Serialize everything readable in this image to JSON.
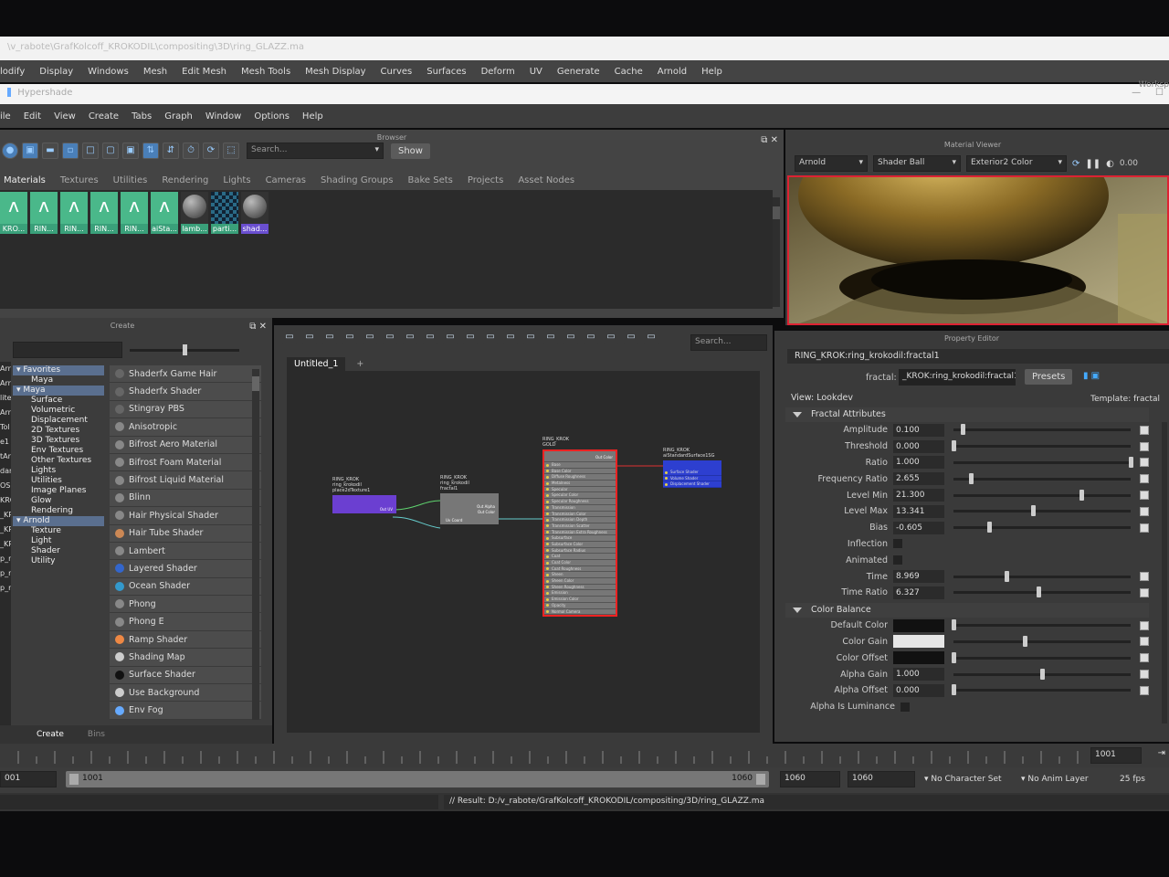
{
  "window": {
    "title": "\\v_rabote\\GrafKolcoff_KROKODIL\\compositing\\3D\\ring_GLAZZ.ma"
  },
  "main_menu": [
    "lodify",
    "Display",
    "Windows",
    "Mesh",
    "Edit Mesh",
    "Mesh Tools",
    "Mesh Display",
    "Curves",
    "Surfaces",
    "Deform",
    "UV",
    "Generate",
    "Cache",
    "Arnold",
    "Help"
  ],
  "workspace_label": "Worksp",
  "hypershade": {
    "title": "Hypershade",
    "menu": [
      "ile",
      "Edit",
      "View",
      "Create",
      "Tabs",
      "Graph",
      "Window",
      "Options",
      "Help"
    ]
  },
  "browser": {
    "title": "Browser",
    "search_placeholder": "Search...",
    "show_label": "Show",
    "tabs": [
      "Materials",
      "Textures",
      "Utilities",
      "Rendering",
      "Lights",
      "Cameras",
      "Shading Groups",
      "Bake Sets",
      "Projects",
      "Asset Nodes"
    ],
    "swatches": [
      {
        "label": "KRO...",
        "kind": "arnold"
      },
      {
        "label": "RIN...",
        "kind": "arnold"
      },
      {
        "label": "RIN...",
        "kind": "arnold"
      },
      {
        "label": "RIN...",
        "kind": "arnold"
      },
      {
        "label": "RIN...",
        "kind": "arnold"
      },
      {
        "label": "aiSta...",
        "kind": "arnold"
      },
      {
        "label": "lamb...",
        "kind": "sphere"
      },
      {
        "label": "parti...",
        "kind": "checker"
      },
      {
        "label": "shad...",
        "kind": "sphere"
      }
    ]
  },
  "material_viewer": {
    "title": "Material Viewer",
    "renderer": "Arnold",
    "shape": "Shader Ball",
    "env": "Exterior2 Color",
    "exposure": "0.00"
  },
  "create_panel": {
    "title": "Create",
    "tree": [
      {
        "label": "Favorites",
        "level": 0,
        "selected": true
      },
      {
        "label": "Maya",
        "level": 1,
        "selected": false
      },
      {
        "label": "Maya",
        "level": 0,
        "selected": true
      },
      {
        "label": "Surface",
        "level": 1,
        "selected": false
      },
      {
        "label": "Volumetric",
        "level": 1,
        "selected": false
      },
      {
        "label": "Displacement",
        "level": 1,
        "selected": false
      },
      {
        "label": "2D Textures",
        "level": 1,
        "selected": false
      },
      {
        "label": "3D Textures",
        "level": 1,
        "selected": false
      },
      {
        "label": "Env Textures",
        "level": 1,
        "selected": false
      },
      {
        "label": "Other Textures",
        "level": 1,
        "selected": false
      },
      {
        "label": "Lights",
        "level": 1,
        "selected": false
      },
      {
        "label": "Utilities",
        "level": 1,
        "selected": false
      },
      {
        "label": "Image Planes",
        "level": 1,
        "selected": false
      },
      {
        "label": "Glow",
        "level": 1,
        "selected": false
      },
      {
        "label": "Rendering",
        "level": 1,
        "selected": false
      },
      {
        "label": "Arnold",
        "level": 0,
        "selected": true
      },
      {
        "label": "Texture",
        "level": 1,
        "selected": false
      },
      {
        "label": "Light",
        "level": 1,
        "selected": false
      },
      {
        "label": "Shader",
        "level": 1,
        "selected": false
      },
      {
        "label": "Utility",
        "level": 1,
        "selected": false
      }
    ],
    "nodes": [
      "Shaderfx Game Hair",
      "Shaderfx Shader",
      "Stingray PBS",
      "Anisotropic",
      "Bifrost Aero Material",
      "Bifrost Foam Material",
      "Bifrost Liquid Material",
      "Blinn",
      "Hair Physical Shader",
      "Hair Tube Shader",
      "Lambert",
      "Layered Shader",
      "Ocean Shader",
      "Phong",
      "Phong E",
      "Ramp Shader",
      "Shading Map",
      "Surface Shader",
      "Use Background",
      "Env Fog"
    ],
    "bottom_tabs": [
      "Create",
      "Bins"
    ]
  },
  "left_clip": [
    "Arr",
    "Arr",
    "lite",
    "Arr",
    "Tol",
    "e1",
    "tArr",
    "dar",
    "OSKI",
    "KRO",
    "_KRO",
    "_KRO",
    "_KRO",
    "p_rot",
    "p_rot",
    "p_rot"
  ],
  "graph": {
    "tab": "Untitled_1",
    "search_placeholder": "Search...",
    "nodes": {
      "place2d": {
        "title": "RING_KROK\nring_krokodil\nplace2dTexture1",
        "port": "Out UV"
      },
      "fractal": {
        "title": "RING_KROK\nring_krokodil\nfractal1",
        "ports": [
          "Out Alpha",
          "Out Color"
        ],
        "in_port": "Uv Coord"
      },
      "gold": {
        "title": "RING_KROK\nGOLD",
        "out": "Out Color",
        "ports": [
          "Base",
          "Base Color",
          "Diffuse Roughness",
          "Metalness",
          "Specular",
          "Specular Color",
          "Specular Roughness",
          "Transmission",
          "Transmission Color",
          "Transmission Depth",
          "Transmission Scatter",
          "Transmission Extra Roughness",
          "Subsurface",
          "Subsurface Color",
          "Subsurface Radius",
          "Coat",
          "Coat Color",
          "Coat Roughness",
          "Sheen",
          "Sheen Color",
          "Sheen Roughness",
          "Emission",
          "Emission Color",
          "Opacity",
          "Normal Camera"
        ]
      },
      "sg": {
        "title": "RING_KROK\naiStandardSurface1SG",
        "ports": [
          "Surface Shader",
          "Volume Shader",
          "Displacement Shader"
        ]
      }
    }
  },
  "property_editor": {
    "title": "Property Editor",
    "node_path": "RING_KROK:ring_krokodil:fractal1",
    "field_label": "fractal:",
    "field_value": "_KROK:ring_krokodil:fractal1",
    "presets": "Presets",
    "view": "View: Lookdev",
    "template": "Template: fractal",
    "fractal_section": "Fractal Attributes",
    "fractal_attrs": [
      {
        "k": "Amplitude",
        "v": "0.100",
        "pos": 0.05
      },
      {
        "k": "Threshold",
        "v": "0.000",
        "pos": 0.0
      },
      {
        "k": "Ratio",
        "v": "1.000",
        "pos": 1.0
      },
      {
        "k": "Frequency Ratio",
        "v": "2.655",
        "pos": 0.1
      },
      {
        "k": "Level Min",
        "v": "21.300",
        "pos": 0.72
      },
      {
        "k": "Level Max",
        "v": "13.341",
        "pos": 0.45
      },
      {
        "k": "Bias",
        "v": "-0.605",
        "pos": 0.2
      }
    ],
    "inflection": "Inflection",
    "animated": "Animated",
    "time_attrs": [
      {
        "k": "Time",
        "v": "8.969",
        "pos": 0.3
      },
      {
        "k": "Time Ratio",
        "v": "6.327",
        "pos": 0.48
      }
    ],
    "color_section": "Color Balance",
    "color_attrs": [
      {
        "k": "Default Color",
        "color": "#111111",
        "pos": 0.0
      },
      {
        "k": "Color Gain",
        "color": "#e6e6e6",
        "pos": 0.4
      },
      {
        "k": "Color Offset",
        "color": "#111111",
        "pos": 0.0
      }
    ],
    "alpha_attrs": [
      {
        "k": "Alpha Gain",
        "v": "1.000",
        "pos": 0.5
      },
      {
        "k": "Alpha Offset",
        "v": "0.000",
        "pos": 0.0
      }
    ],
    "alpha_lum": "Alpha Is Luminance"
  },
  "timeline": {
    "end_frame": "1001",
    "start": "1001",
    "range_start": "1001",
    "range_end": "1060",
    "f1": "1060",
    "f2": "1060",
    "character": "No Character Set",
    "anim_layer": "No Anim Layer",
    "fps": "25 fps",
    "left_field": "001"
  },
  "status": {
    "result": "// Result: D:/v_rabote/GrafKolcoff_KROKODIL/compositing/3D/ring_GLAZZ.ma"
  }
}
